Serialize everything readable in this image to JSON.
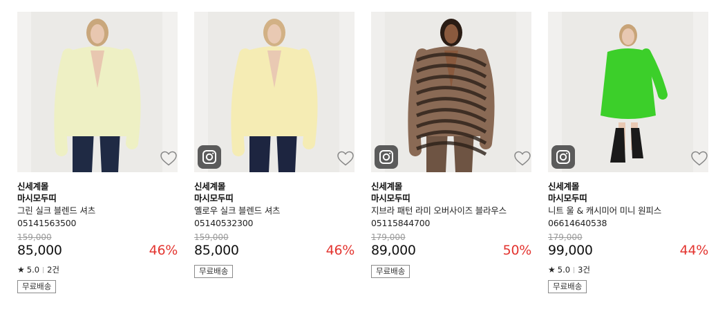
{
  "products": [
    {
      "tag": "신세계몰",
      "brand": "마시모두띠",
      "name": "그린 실크 블렌드 셔츠",
      "code": "05141563500",
      "original_price": "159,000",
      "price": "85,000",
      "discount": "46%",
      "rating": "5.0",
      "review_count": "2건",
      "shipping": "무료배송",
      "has_instagram": false,
      "photo_colors": {
        "bg": "#f2f1ef",
        "garment": "#eef0c4",
        "pants": "#1f2a44",
        "skin": "#e8c7b0",
        "hair": "#c9a77c"
      }
    },
    {
      "tag": "신세계몰",
      "brand": "마시모두띠",
      "name": "옐로우 실크 블렌드 셔츠",
      "code": "05140532300",
      "original_price": "159,000",
      "price": "85,000",
      "discount": "46%",
      "shipping": "무료배송",
      "has_instagram": true,
      "photo_colors": {
        "bg": "#f1f0ee",
        "garment": "#f5ecb4",
        "pants": "#1d2540",
        "skin": "#e9c9b3",
        "hair": "#d2b185"
      }
    },
    {
      "tag": "신세계몰",
      "brand": "마시모두띠",
      "name": "지브라 패턴 라미 오버사이즈 블라우스 05115844700",
      "code": "",
      "original_price": "179,000",
      "price": "89,000",
      "discount": "50%",
      "shipping": "무료배송",
      "has_instagram": true,
      "photo_colors": {
        "bg": "#f0efed",
        "garment": "#8a6a55",
        "pants": "#6e5443",
        "skin": "#8a5a3e",
        "hair": "#2a1c14"
      }
    },
    {
      "tag": "신세계몰",
      "brand": "마시모두띠",
      "name": "니트 울 & 캐시미어 미니 원피스",
      "code": "06614640538",
      "original_price": "179,000",
      "price": "99,000",
      "discount": "44%",
      "rating": "5.0",
      "review_count": "3건",
      "shipping": "무료배송",
      "has_instagram": true,
      "photo_colors": {
        "bg": "#f1f0ee",
        "garment": "#3ccf2a",
        "pants": "#1a1a1a",
        "skin": "#e8c8b2",
        "hair": "#c8a478"
      }
    }
  ],
  "icons": {
    "favorite": "heart-outline-icon",
    "instagram": "instagram-icon",
    "rating": "star-icon"
  },
  "colors": {
    "discount": "#e3342f",
    "original_price": "#9a9a9a",
    "instagram_badge": "#5b5b5b"
  }
}
